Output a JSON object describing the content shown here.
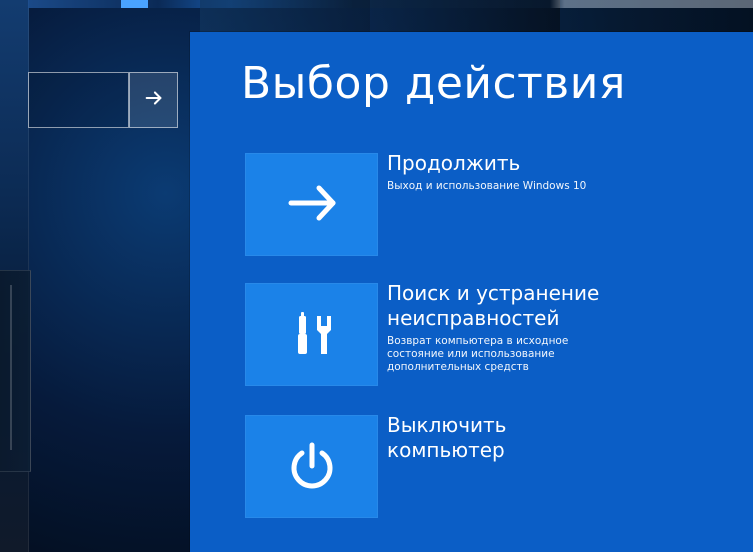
{
  "login": {
    "submit_icon": "arrow-right-icon"
  },
  "panel": {
    "title": "Выбор действия",
    "options": [
      {
        "label": "Продолжить",
        "description": "Выход и использование Windows 10",
        "icon": "arrow-right-icon"
      },
      {
        "label": "Поиск и устранение\nнеисправностей",
        "description": "Возврат компьютера в исходное\nсостояние или использование\nдополнительных средств",
        "icon": "tools-icon"
      },
      {
        "label": "Выключить\nкомпьютер",
        "description": "",
        "icon": "power-icon"
      }
    ]
  },
  "colors": {
    "panel": "#0b5ec6",
    "tile": "#1b82e8",
    "text": "#ffffff"
  }
}
